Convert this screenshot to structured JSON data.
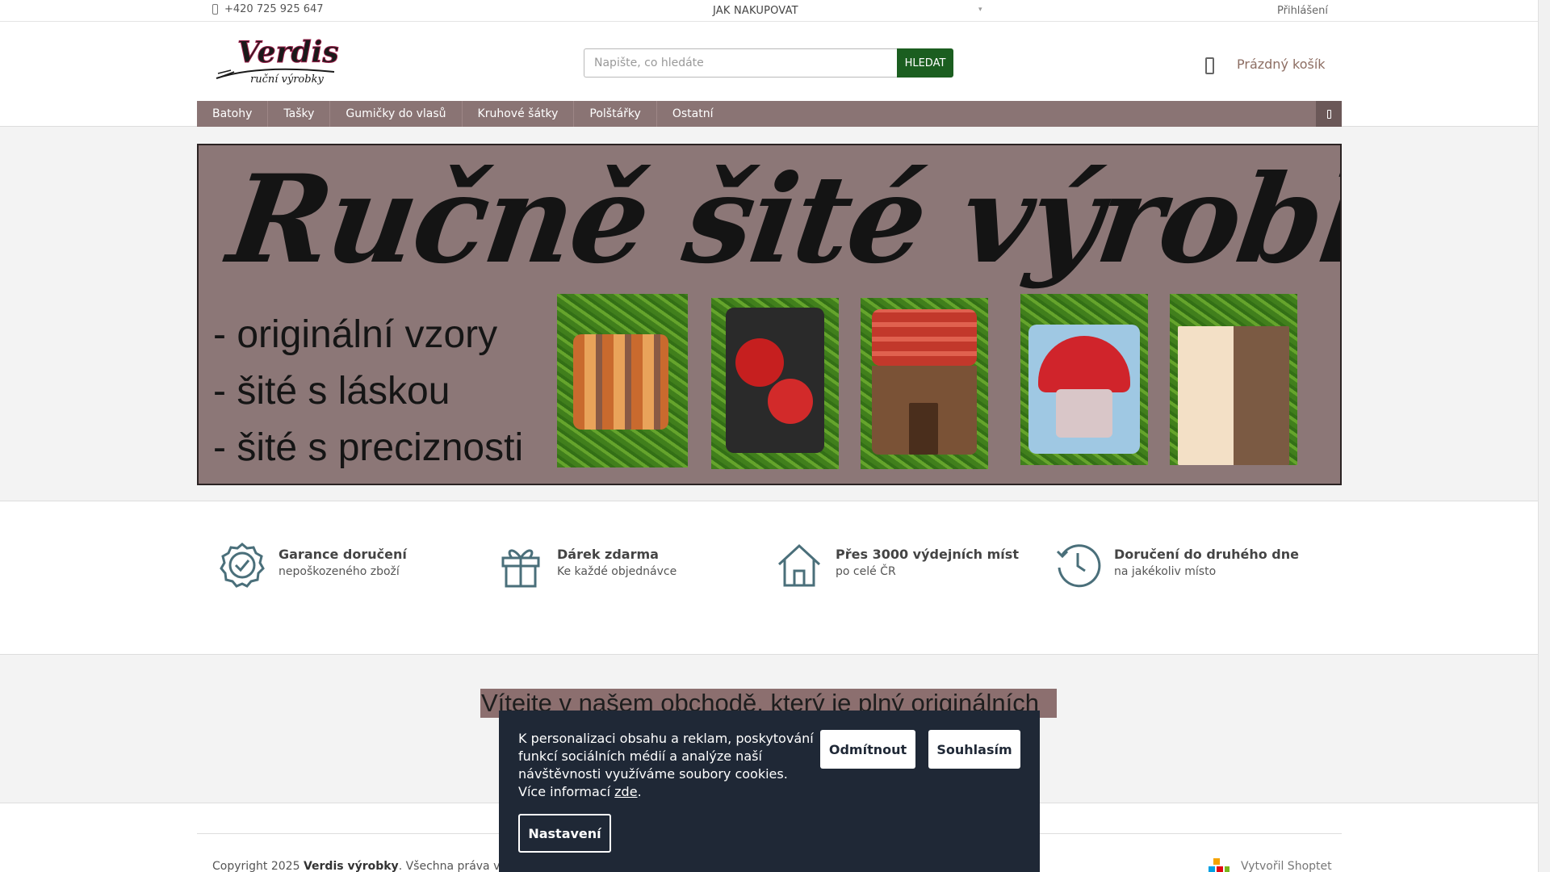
{
  "topbar": {
    "phone": "+420 725 925 647",
    "how_to_buy": "JAK NAKUPOVAT",
    "login": "Přihlášení"
  },
  "header": {
    "logo_text": "Verdis",
    "logo_sub": "ruční výrobky",
    "search_placeholder": "Napište, co hledáte",
    "search_button": "HLEDAT",
    "cart_label": "Prázdný košík"
  },
  "nav": {
    "items": [
      "Batohy",
      "Tašky",
      "Gumičky do vlasů",
      "Kruhové šátky",
      "Polštářky",
      "Ostatní"
    ]
  },
  "banner": {
    "title": "Ručně šité výrobky",
    "lines": [
      "- originální vzory",
      "- šité s láskou",
      "- šité s preciznosti"
    ],
    "background": "#8c7777"
  },
  "benefits": [
    {
      "title": "Garance doručení",
      "subtitle": "nepoškozeného zboží",
      "icon": "badge-check-icon"
    },
    {
      "title": "Dárek zdarma",
      "subtitle": "Ke každé objednávce",
      "icon": "gift-icon"
    },
    {
      "title": "Přes 3000 výdejních míst",
      "subtitle": "po celé ČR",
      "icon": "home-icon"
    },
    {
      "title": "Doručení do druhého dne",
      "subtitle": "na jakékoliv místo",
      "icon": "clock-icon"
    }
  ],
  "welcome": {
    "text": "Vítejte v našem obchodě, který je plný originálních"
  },
  "footer": {
    "copyright_prefix": "Copyright 2025",
    "shop_name": "Verdis výrobky",
    "copyright_suffix": ". Všechna práva vyhrazena.",
    "shoptet": "Vytvořil Shoptet"
  },
  "cookie": {
    "text": "K personalizaci obsahu a reklam, poskytování funkcí sociálních médií a analýze naší návštěvnosti využíváme soubory cookies. Více informací",
    "link": "zde",
    "reject": "Odmítnout",
    "accept": "Souhlasím",
    "settings": "Nastavení"
  },
  "colors": {
    "accent": "#1b5e20",
    "nav": "#8a7474",
    "cookie_bg": "#1f2836",
    "icon": "#4a6f7a"
  }
}
